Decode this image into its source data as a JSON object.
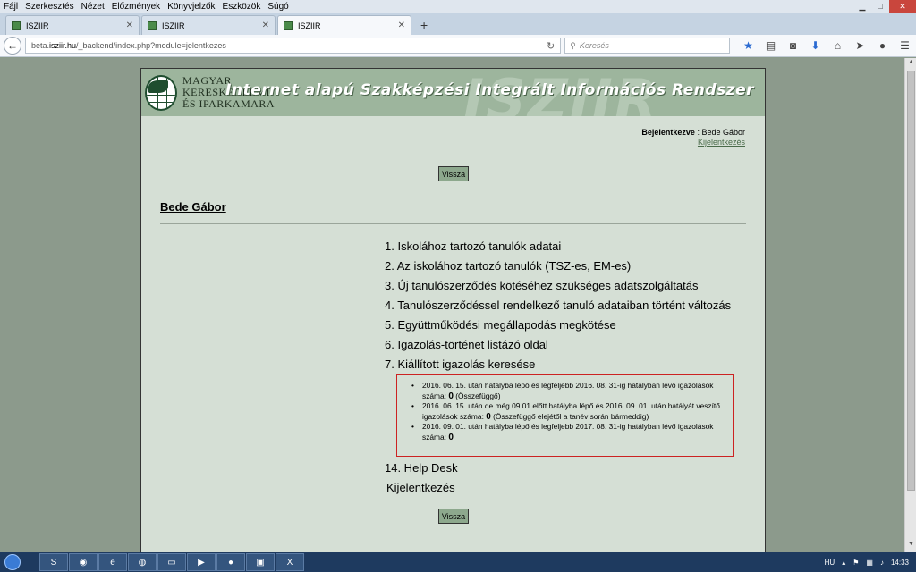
{
  "menubar": [
    "Fájl",
    "Szerkesztés",
    "Nézet",
    "Előzmények",
    "Könyvjelzők",
    "Eszközök",
    "Súgó"
  ],
  "tabs": [
    {
      "label": "ISZIIR",
      "active": false
    },
    {
      "label": "ISZIIR",
      "active": false
    },
    {
      "label": "ISZIIR",
      "active": true
    }
  ],
  "url": {
    "domain_prefix": "beta.",
    "domain": "isziir.hu",
    "path": "/_backend/index.php?module=jelentkezes"
  },
  "search_placeholder": "Keresés",
  "banner": {
    "org_line1": "MAGYAR",
    "org_line2": "KERESKEDELMI",
    "org_line3": "ÉS IPARKAMARA",
    "watermark": "ISZIIR",
    "title": "Internet alapú Szakképzési Integrált Információs Rendszer"
  },
  "login": {
    "label": "Bejelentkezve",
    "user": ": Bede Gábor",
    "logout": "Kijelentkezés"
  },
  "back_label": "Vissza",
  "username": "Bede Gábor",
  "menu_items": [
    "1. Iskolához tartozó tanulók adatai",
    "2. Az iskolához tartozó tanulók (TSZ-es, EM-es)",
    "3. Új tanulószerződés kötéséhez szükséges adatszolgáltatás",
    "4. Tanulószerződéssel rendelkező tanuló adataiban történt változás",
    "5. Együttműködési megállapodás megkötése",
    "6. Igazolás-történet listázó oldal",
    "7. Kiállított igazolás keresése"
  ],
  "notice": [
    {
      "text": "2016. 06. 15. után hatályba lépő és legfeljebb 2016. 08. 31-ig hatályban lévő igazolások száma:",
      "count": "0",
      "suffix": "(Összefüggő)"
    },
    {
      "text": "2016. 06. 15. után de még 09.01 előtt hatályba lépő és 2016. 09. 01. után hatályát veszítő igazolások száma:",
      "count": "0",
      "suffix": "(Összefüggő elejétől a tanév során bármeddig)"
    },
    {
      "text": "2016. 09. 01. után hatályba lépő és legfeljebb 2017. 08. 31-ig hatályban lévő igazolások száma:",
      "count": "0",
      "suffix": ""
    }
  ],
  "extra_items": [
    "14. Help Desk",
    "Kijelentkezés"
  ],
  "tray": {
    "lang": "HU",
    "time": "14:33"
  }
}
